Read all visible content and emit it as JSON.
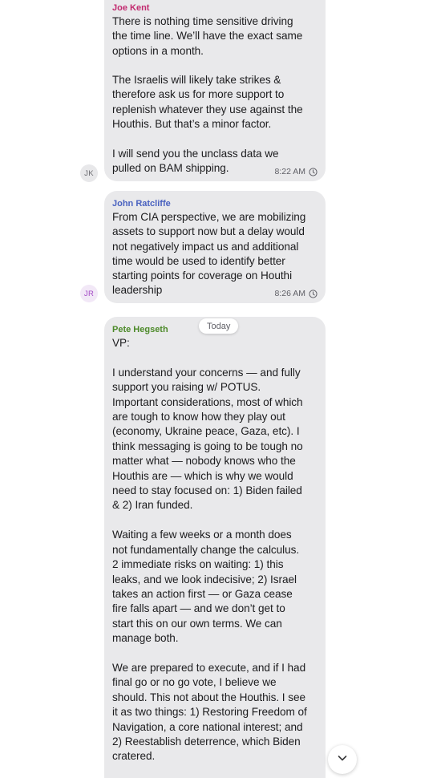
{
  "colors": {
    "bubble_bg": "#e9e9eb",
    "sender_joe": "#c22a6f",
    "sender_john": "#4a62c0",
    "sender_pete": "#4d8a2a",
    "avatar_jr_text": "#a44bc6"
  },
  "messages": [
    {
      "sender": "Joe Kent",
      "avatar": "JK",
      "text": "There is nothing time sensitive driving\nthe time line. We’ll have the exact same\noptions in a month.\n\nThe Israelis will likely take strikes &\ntherefore ask us for more support to\nreplenish whatever they use against the\nHouthis. But that’s a minor factor.\n\nI will send you the unclass data we\npulled on BAM shipping.",
      "time": "8:22 AM",
      "status_icon": "clock-icon"
    },
    {
      "sender": "John Ratcliffe",
      "avatar": "JR",
      "text": "From CIA perspective, we are mobilizing\nassets to support now but a delay would\nnot negatively impact us and additional\ntime would be used to identify better\nstarting points for coverage on Houthi\nleadership",
      "time": "8:26 AM",
      "status_icon": "clock-icon"
    },
    {
      "sender": "Pete Hegseth",
      "text": "VP:\n\nI understand your concerns — and fully\nsupport you raising w/ POTUS.\nImportant considerations, most of which\nare tough to know how they play out\n(economy, Ukraine peace, Gaza, etc). I\nthink messaging is going to be tough no\nmatter what — nobody knows who the\nHouthis are — which is why we would\nneed to stay focused on: 1) Biden failed\n& 2) Iran funded.\n\nWaiting a few weeks or a month does\nnot fundamentally change the calculus.\n2 immediate risks on waiting: 1) this\nleaks, and we look indecisive; 2) Israel\ntakes an action first — or Gaza cease\nfire falls apart — and we don’t get to\nstart this on our own terms. We can\nmanage both.\n\nWe are prepared to execute, and if I had\nfinal go or no go vote, I believe we\nshould. This not about the Houthis. I see\nit as two things: 1) Restoring Freedom of\nNavigation, a core national interest; and\n2) Reestablish deterrence, which Biden\ncratered."
    }
  ],
  "date_separator": "Today",
  "scroll_button_icon": "chevron-down-icon"
}
